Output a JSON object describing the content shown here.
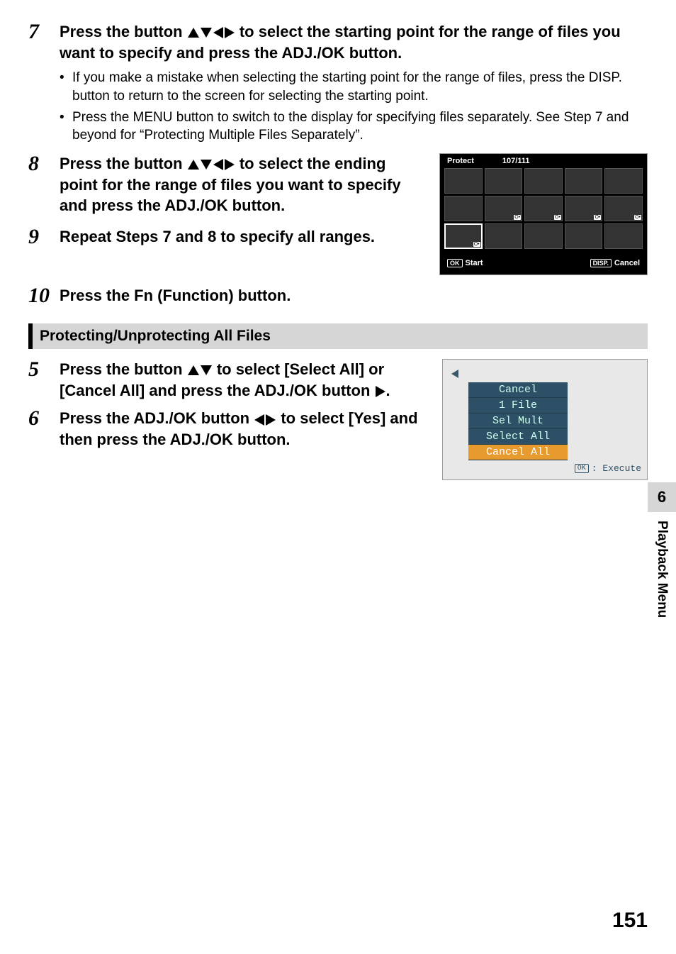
{
  "steps": {
    "s7": {
      "num": "7",
      "title_a": "Press the button ",
      "title_b": " to select the starting point for the range of files you want to specify and press the ADJ./OK button.",
      "b1": "If you make a mistake when selecting the starting point for the range of files, press the DISP. button to return to the screen for selecting the starting point.",
      "b2": "Press the MENU button to switch to the display for specifying files separately. See Step 7 and beyond for “Protecting Multiple Files Separately”."
    },
    "s8": {
      "num": "8",
      "title_a": "Press the button ",
      "title_b": " to select the ending point for the range of files you want to specify and press the ADJ./OK button."
    },
    "s9": {
      "num": "9",
      "title": "Repeat Steps 7 and 8 to specify all ranges."
    },
    "s10": {
      "num": "10",
      "title": "Press the Fn (Function) button."
    },
    "s5": {
      "num": "5",
      "title_a": "Press the button ",
      "title_b": " to select [Select All] or [Cancel All] and press the ADJ./OK button ",
      "title_c": "."
    },
    "s6": {
      "num": "6",
      "title_a": "Press the ADJ./OK button ",
      "title_b": " to select [Yes] and then press the ADJ./OK button."
    }
  },
  "section_title": "Protecting/Unprotecting All Files",
  "shot1": {
    "title": "Protect",
    "counter": "107/111",
    "ok": "OK",
    "start": "Start",
    "disp": "DISP.",
    "cancel": "Cancel",
    "prot_marks": [
      6,
      7,
      8,
      9,
      10
    ]
  },
  "shot2": {
    "items": [
      "Cancel",
      "1 File",
      "Sel Mult",
      "Select All",
      "Cancel All"
    ],
    "selected": 4,
    "ok": "OK",
    "exec": ": Execute"
  },
  "side": {
    "chapter": "6",
    "label": "Playback Menu"
  },
  "page_number": "151"
}
